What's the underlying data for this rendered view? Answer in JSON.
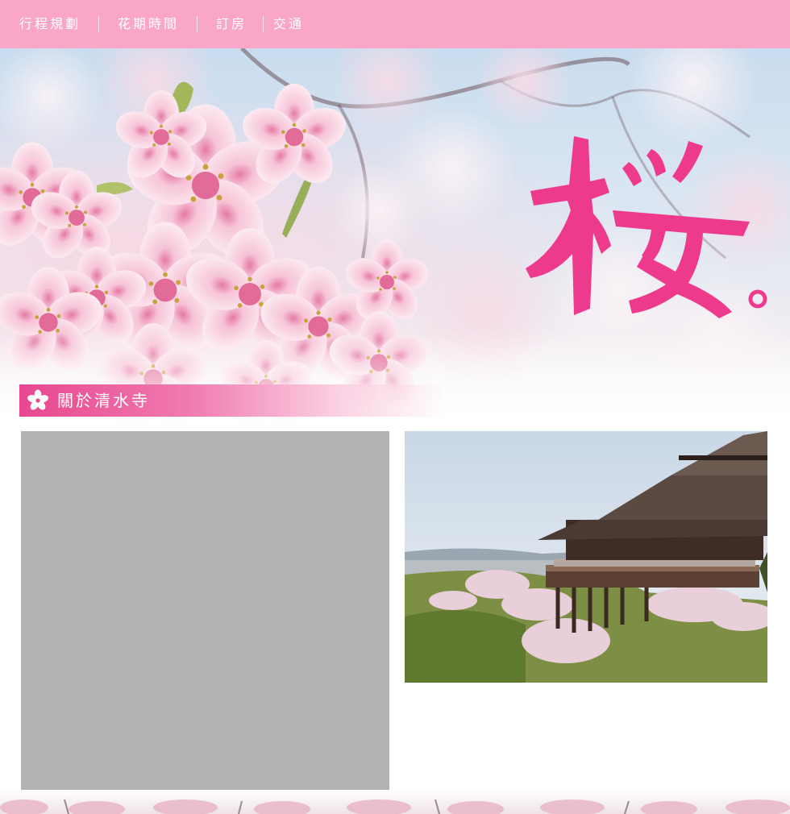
{
  "nav": {
    "items": [
      "行程規劃",
      "花期時間",
      "訂房",
      "交通"
    ]
  },
  "hero": {
    "image": "cherry-blossom-hero",
    "title_logo": "桜。"
  },
  "section": {
    "title": "關於清水寺",
    "icon": "sakura-flower-icon"
  },
  "content": {
    "left_image": "gray-placeholder-image",
    "right_image": "kiyomizu-dera-temple-photo"
  },
  "colors": {
    "nav_bg": "#f9a6c8",
    "accent": "#e8478f",
    "logo_pink": "#ee3a8c",
    "placeholder": "#b3b3b3"
  }
}
